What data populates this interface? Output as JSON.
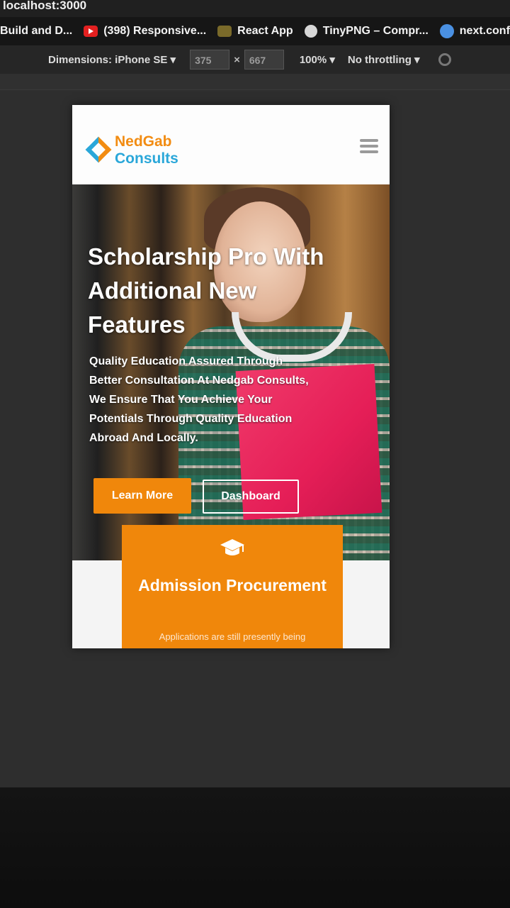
{
  "browser": {
    "url": "localhost:3000",
    "bookmarks": [
      {
        "label": "Build and D...",
        "icon": "folder-icon"
      },
      {
        "label": "(398) Responsive...",
        "icon": "youtube-icon"
      },
      {
        "label": "React App",
        "icon": "react-icon"
      },
      {
        "label": "TinyPNG – Compr...",
        "icon": "tinypng-icon"
      },
      {
        "label": "next.config.js –",
        "icon": "github-icon"
      }
    ]
  },
  "devtools": {
    "dimensions_label": "Dimensions: iPhone SE ▾",
    "width": "375",
    "times": "×",
    "height": "667",
    "zoom": "100% ▾",
    "throttling": "No throttling ▾"
  },
  "site": {
    "brand_line1": "NedGab",
    "brand_line2": "Consults",
    "hero_title": "Scholarship Pro With Additional New Features",
    "hero_text": "Quality Education Assured Through Better Consultation At Nedgab Consults, We Ensure That You Achieve Your Potentials Through Quality Education Abroad And Locally.",
    "learn_more": "Learn More",
    "dashboard": "Dashboard",
    "card_title": "Admission Procurement",
    "card_text": "Applications are still presently being"
  },
  "colors": {
    "accent": "#f0870b",
    "brand_blue": "#2aa7d9",
    "folder_pink": "#e51e57"
  }
}
